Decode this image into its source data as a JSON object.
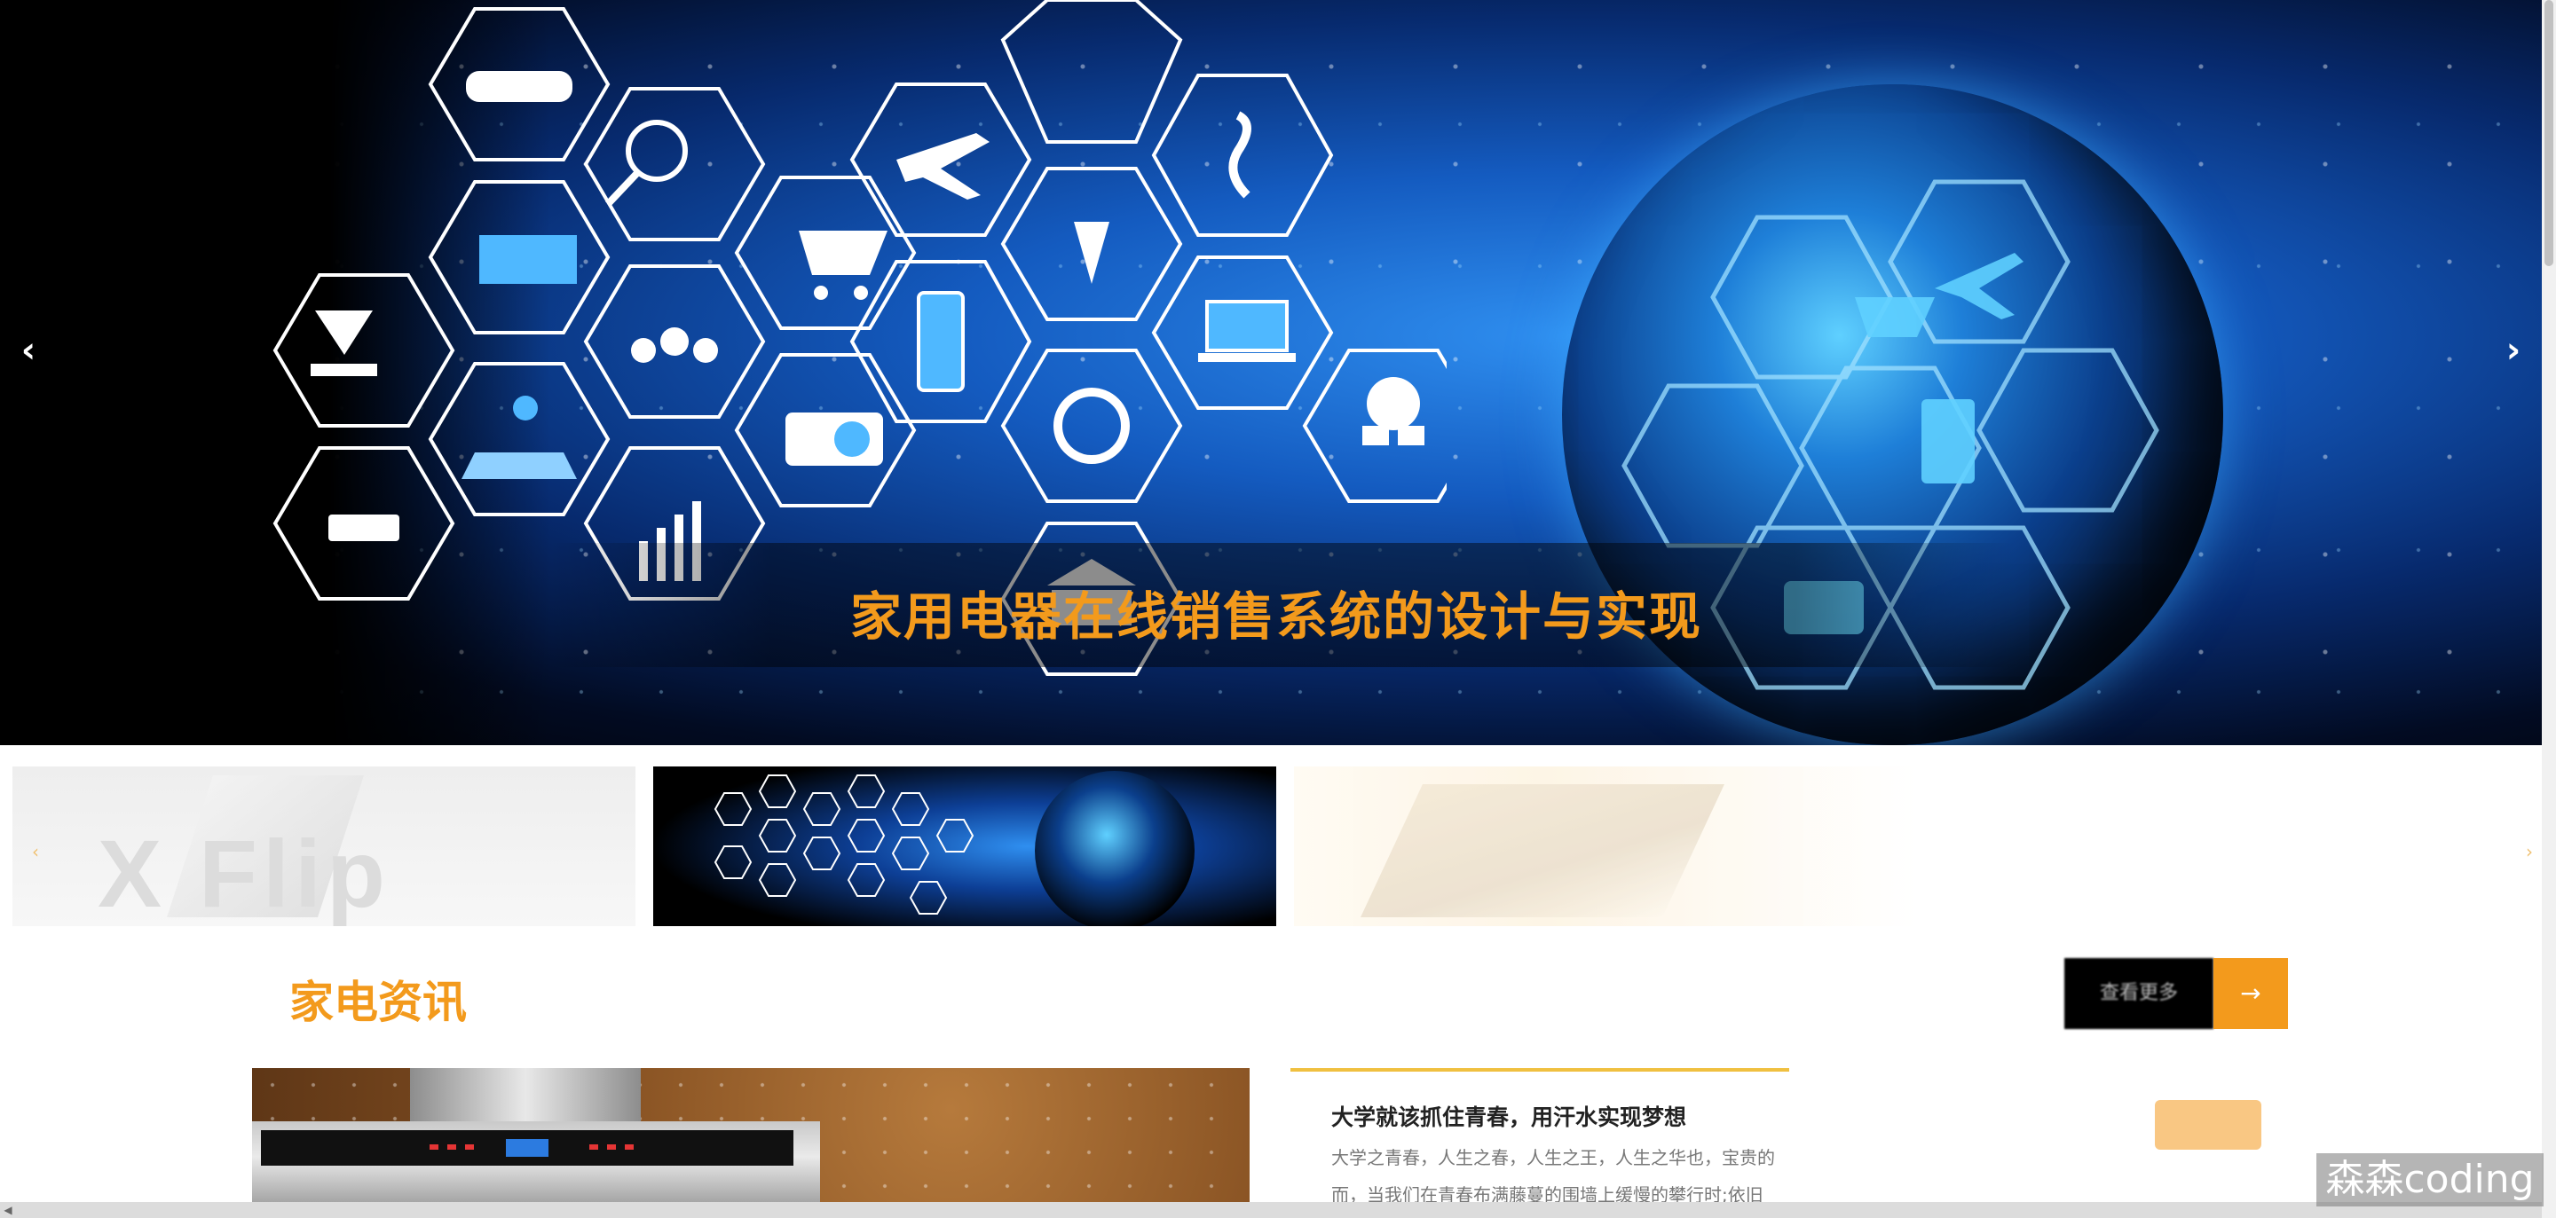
{
  "hero": {
    "caption": "家用电器在线销售系统的设计与实现",
    "prev_icon": "‹",
    "next_icon": "›"
  },
  "thumbnails": [
    {
      "label": "X Flip"
    },
    {
      "label": ""
    },
    {
      "label": ""
    }
  ],
  "news": {
    "title": "家电资讯",
    "side_button": "查看更多",
    "side_icon": "→",
    "card": {
      "title": "大学就该抓住青春，用汗水实现梦想",
      "text": "大学之青春，人生之春，人生之王，人生之华也，宝贵的而，当我们在青春布满藤蔓的围墙上缓慢的攀行时;依旧"
    }
  },
  "watermark": "森森coding",
  "colors": {
    "accent": "#f39a1c",
    "hero_blue": "#145bc0",
    "card_line": "#f0c040"
  },
  "icons": [
    "arrow-left-icon",
    "arrow-right-icon",
    "car-icon",
    "magnifier-icon",
    "globe-icon",
    "airplane-icon",
    "info-icon",
    "cart-icon",
    "film-icon",
    "download-icon",
    "people-icon",
    "phone-icon",
    "caduceus-icon",
    "laptop-icon",
    "map-pin-icon",
    "camera-icon",
    "gear-icon",
    "cloud-icon",
    "cctv-icon",
    "chart-icon",
    "bank-icon"
  ]
}
